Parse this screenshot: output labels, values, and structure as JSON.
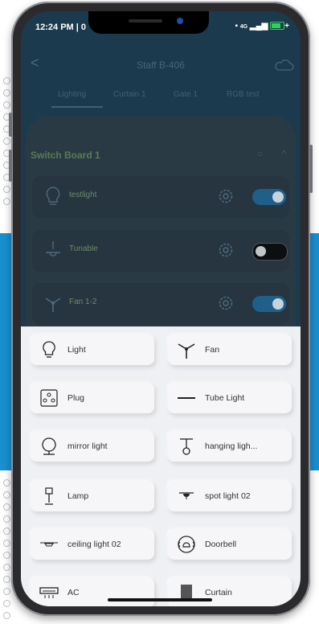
{
  "status": {
    "time": "12:24 PM | 0",
    "signal": "4G",
    "battery": "+"
  },
  "header": {
    "back_glyph": "<",
    "title": "Staff B-406"
  },
  "tabs": [
    "Lighting",
    "Curtain 1",
    "Gate 1",
    "RGB test"
  ],
  "switch_board": {
    "title": "Switch Board 1",
    "devices": [
      {
        "name": "testlight",
        "icon": "bulb-icon",
        "state": "on"
      },
      {
        "name": "Tunable",
        "icon": "tunable-icon",
        "state": "off"
      },
      {
        "name": "Fan 1-2",
        "icon": "fan-icon",
        "state": "on"
      }
    ]
  },
  "device_types": [
    {
      "label": "Light",
      "icon": "bulb-icon"
    },
    {
      "label": "Fan",
      "icon": "fan-icon"
    },
    {
      "label": "Plug",
      "icon": "plug-icon"
    },
    {
      "label": "Tube Light",
      "icon": "tube-light-icon"
    },
    {
      "label": "mirror light",
      "icon": "mirror-light-icon"
    },
    {
      "label": "hanging ligh...",
      "icon": "hanging-light-icon"
    },
    {
      "label": "Lamp",
      "icon": "lamp-icon"
    },
    {
      "label": "spot light 02",
      "icon": "spot-light-icon"
    },
    {
      "label": "ceiling light 02",
      "icon": "ceiling-light-icon"
    },
    {
      "label": "Doorbell",
      "icon": "doorbell-icon"
    },
    {
      "label": "AC",
      "icon": "ac-icon"
    },
    {
      "label": "Curtain",
      "icon": "curtain-icon"
    }
  ],
  "colors": {
    "accent_blue": "#1a8fd0",
    "app_header": "#1c3a4e",
    "toggle_on": "#1f5f8a"
  }
}
